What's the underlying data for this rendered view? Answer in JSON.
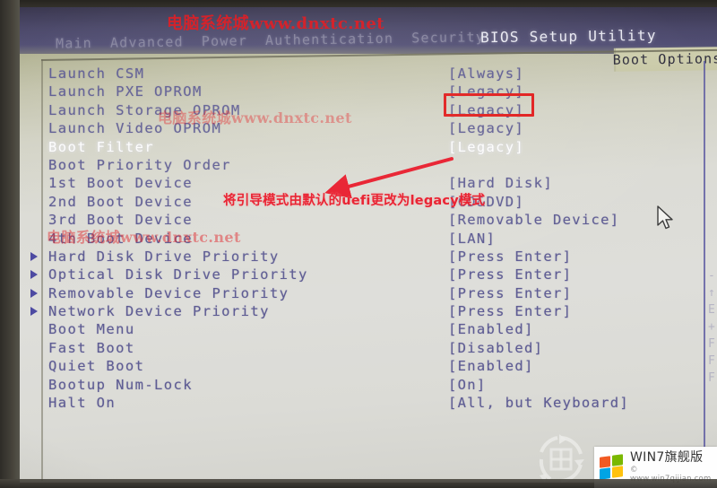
{
  "header": {
    "title": "BIOS Setup Utility",
    "menu_items": [
      "Main",
      "Advanced",
      "Power",
      "Authentication",
      "Security"
    ],
    "active_tab": "Boot Options"
  },
  "rows": [
    {
      "label": "Launch CSM",
      "value": "[Always]",
      "arrow": false,
      "selected": false
    },
    {
      "label": "Launch PXE OPROM",
      "value": "[Legacy]",
      "arrow": false,
      "selected": false
    },
    {
      "label": "Launch Storage OPROM",
      "value": "[Legacy]",
      "arrow": false,
      "selected": false
    },
    {
      "label": "Launch Video OPROM",
      "value": "[Legacy]",
      "arrow": false,
      "selected": false
    },
    {
      "label": "Boot Filter",
      "value": "[Legacy]",
      "arrow": false,
      "selected": true
    },
    {
      "label": "Boot Priority Order",
      "value": "",
      "arrow": false,
      "selected": false
    },
    {
      "label": "1st Boot Device",
      "value": "[Hard Disk]",
      "arrow": false,
      "selected": false
    },
    {
      "label": "2nd Boot Device",
      "value": "[CD&DVD]",
      "arrow": false,
      "selected": false
    },
    {
      "label": "3rd Boot Device",
      "value": "[Removable Device]",
      "arrow": false,
      "selected": false
    },
    {
      "label": "4th Boot Device",
      "value": "[LAN]",
      "arrow": false,
      "selected": false
    },
    {
      "label": "Hard Disk Drive Priority",
      "value": "[Press Enter]",
      "arrow": true,
      "selected": false
    },
    {
      "label": "Optical Disk Drive Priority",
      "value": "[Press Enter]",
      "arrow": true,
      "selected": false
    },
    {
      "label": "Removable Device Priority",
      "value": "[Press Enter]",
      "arrow": true,
      "selected": false
    },
    {
      "label": "Network Device Priority",
      "value": "[Press Enter]",
      "arrow": true,
      "selected": false
    },
    {
      "label": "Boot Menu",
      "value": "[Enabled]",
      "arrow": false,
      "selected": false
    },
    {
      "label": "Fast Boot",
      "value": "[Disabled]",
      "arrow": false,
      "selected": false
    },
    {
      "label": "Quiet Boot",
      "value": "[Enabled]",
      "arrow": false,
      "selected": false
    },
    {
      "label": "Bootup Num-Lock",
      "value": "[On]",
      "arrow": false,
      "selected": false
    },
    {
      "label": "Halt On",
      "value": "[All, but Keyboard]",
      "arrow": false,
      "selected": false
    }
  ],
  "annotation": {
    "text": "将引导模式由默认的uefi更改为legacy模式",
    "color": "#e8192a",
    "target_value": "[Legacy]"
  },
  "watermarks": {
    "top": "电脑系统城www.dnxtc.net",
    "middle": "电脑系统城www.dnxtc.net",
    "lower": "电脑系统城www.dnxtc.net"
  },
  "logo": {
    "title": "WIN7旗舰版",
    "subtitle": "© www.win7qijian.com"
  },
  "colors": {
    "screen_bg": "#dcdcd6",
    "header_bg": "#4b486a",
    "text": "#5e5c93",
    "selected_text": "#fdfdfd",
    "annotation_red": "#e8192a",
    "tab_bg": "#cfcfae"
  }
}
